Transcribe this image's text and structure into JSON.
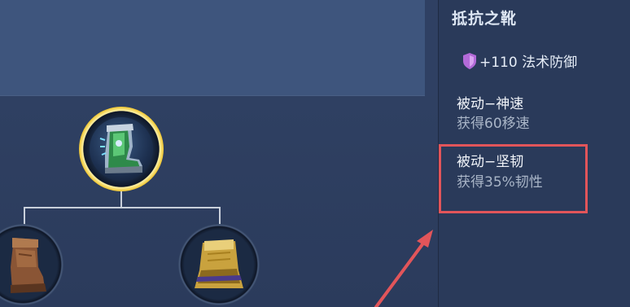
{
  "item": {
    "name": "抵抗之靴",
    "stat": "+110 法术防御"
  },
  "passives": [
    {
      "title": "被动−神速",
      "desc": "获得60移速"
    },
    {
      "title": "被动−坚韧",
      "desc": "获得35%韧性"
    }
  ],
  "tree": {
    "main_icon": "armored-boot-icon",
    "components": [
      "leather-boot-icon",
      "golden-shield-icon"
    ]
  },
  "icons": {
    "stat": "magic-defense-shield-icon"
  },
  "colors": {
    "highlight": "#e2555a",
    "frame_gold": "#f0c93a",
    "stat_icon": "#b36ad8"
  }
}
